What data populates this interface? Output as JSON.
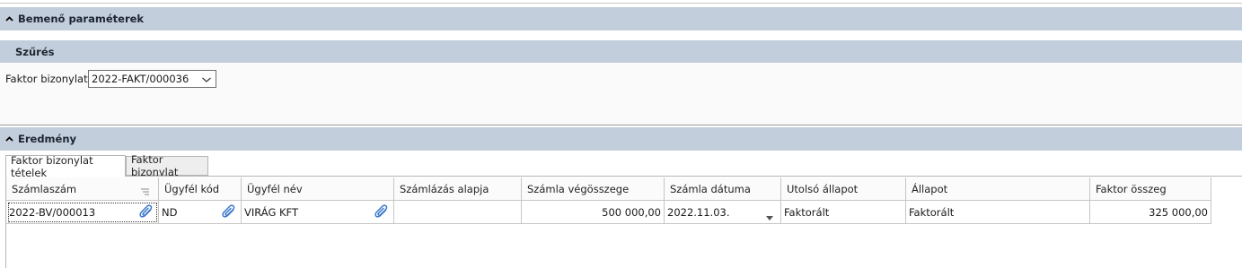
{
  "input_section": {
    "title": "Bemenő paraméterek"
  },
  "filter": {
    "title": "Szűrés",
    "label": "Faktor bizonylat:",
    "value": "2022-FAKT/000036"
  },
  "result_section": {
    "title": "Eredmény"
  },
  "tabs": [
    {
      "label": "Faktor bizonylat tételek",
      "active": true
    },
    {
      "label": "Faktor bizonylat",
      "active": false
    }
  ],
  "grid": {
    "columns": [
      "Számlaszám",
      "Ügyfél kód",
      "Ügyfél név",
      "Számlázás alapja",
      "Számla végösszege",
      "Számla dátuma",
      "Utolsó állapot",
      "Állapot",
      "Faktor összeg"
    ],
    "rows": [
      [
        "2022-BV/000013",
        "ND",
        "VIRÁG KFT",
        "",
        "500 000,00",
        "2022.11.03.",
        "Faktorált",
        "Faktorált",
        "325 000,00"
      ]
    ]
  },
  "colors": {
    "header_band": "#c2cedb",
    "border": "#c6c6c6",
    "clip_icon": "#3b78c9"
  }
}
